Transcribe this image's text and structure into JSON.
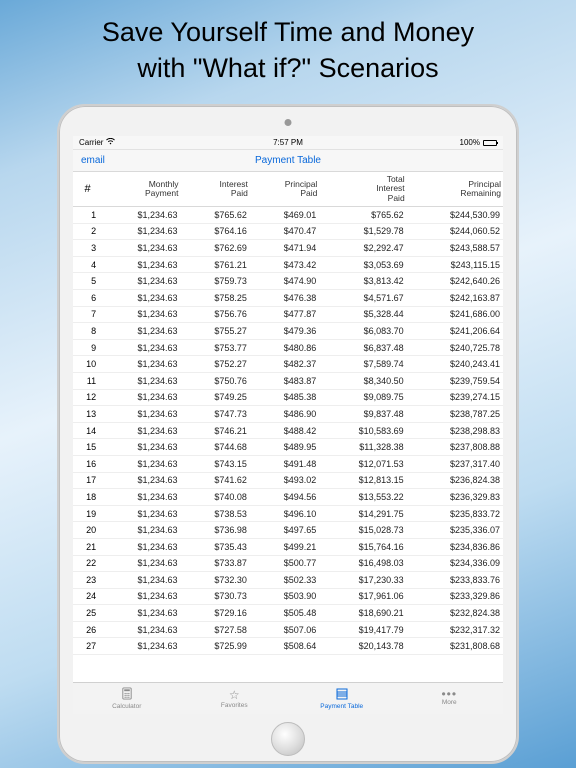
{
  "headline_line1": "Save Yourself Time and Money",
  "headline_line2": "with \"What if?\" Scenarios",
  "statusbar": {
    "carrier": "Carrier",
    "time": "7:57 PM",
    "battery": "100%"
  },
  "navbar": {
    "left": "email",
    "title": "Payment Table"
  },
  "columns": {
    "num": "#",
    "monthly": "Monthly\nPayment",
    "interest": "Interest\nPaid",
    "principal": "Principal\nPaid",
    "total_interest": "Total\nInterest\nPaid",
    "remaining": "Principal\nRemaining"
  },
  "chart_data": {
    "type": "table",
    "title": "Payment Table",
    "columns": [
      "#",
      "Monthly Payment",
      "Interest Paid",
      "Principal Paid",
      "Total Interest Paid",
      "Principal Remaining"
    ],
    "rows": [
      [
        1,
        "$1,234.63",
        "$765.62",
        "$469.01",
        "$765.62",
        "$244,530.99"
      ],
      [
        2,
        "$1,234.63",
        "$764.16",
        "$470.47",
        "$1,529.78",
        "$244,060.52"
      ],
      [
        3,
        "$1,234.63",
        "$762.69",
        "$471.94",
        "$2,292.47",
        "$243,588.57"
      ],
      [
        4,
        "$1,234.63",
        "$761.21",
        "$473.42",
        "$3,053.69",
        "$243,115.15"
      ],
      [
        5,
        "$1,234.63",
        "$759.73",
        "$474.90",
        "$3,813.42",
        "$242,640.26"
      ],
      [
        6,
        "$1,234.63",
        "$758.25",
        "$476.38",
        "$4,571.67",
        "$242,163.87"
      ],
      [
        7,
        "$1,234.63",
        "$756.76",
        "$477.87",
        "$5,328.44",
        "$241,686.00"
      ],
      [
        8,
        "$1,234.63",
        "$755.27",
        "$479.36",
        "$6,083.70",
        "$241,206.64"
      ],
      [
        9,
        "$1,234.63",
        "$753.77",
        "$480.86",
        "$6,837.48",
        "$240,725.78"
      ],
      [
        10,
        "$1,234.63",
        "$752.27",
        "$482.37",
        "$7,589.74",
        "$240,243.41"
      ],
      [
        11,
        "$1,234.63",
        "$750.76",
        "$483.87",
        "$8,340.50",
        "$239,759.54"
      ],
      [
        12,
        "$1,234.63",
        "$749.25",
        "$485.38",
        "$9,089.75",
        "$239,274.15"
      ],
      [
        13,
        "$1,234.63",
        "$747.73",
        "$486.90",
        "$9,837.48",
        "$238,787.25"
      ],
      [
        14,
        "$1,234.63",
        "$746.21",
        "$488.42",
        "$10,583.69",
        "$238,298.83"
      ],
      [
        15,
        "$1,234.63",
        "$744.68",
        "$489.95",
        "$11,328.38",
        "$237,808.88"
      ],
      [
        16,
        "$1,234.63",
        "$743.15",
        "$491.48",
        "$12,071.53",
        "$237,317.40"
      ],
      [
        17,
        "$1,234.63",
        "$741.62",
        "$493.02",
        "$12,813.15",
        "$236,824.38"
      ],
      [
        18,
        "$1,234.63",
        "$740.08",
        "$494.56",
        "$13,553.22",
        "$236,329.83"
      ],
      [
        19,
        "$1,234.63",
        "$738.53",
        "$496.10",
        "$14,291.75",
        "$235,833.72"
      ],
      [
        20,
        "$1,234.63",
        "$736.98",
        "$497.65",
        "$15,028.73",
        "$235,336.07"
      ],
      [
        21,
        "$1,234.63",
        "$735.43",
        "$499.21",
        "$15,764.16",
        "$234,836.86"
      ],
      [
        22,
        "$1,234.63",
        "$733.87",
        "$500.77",
        "$16,498.03",
        "$234,336.09"
      ],
      [
        23,
        "$1,234.63",
        "$732.30",
        "$502.33",
        "$17,230.33",
        "$233,833.76"
      ],
      [
        24,
        "$1,234.63",
        "$730.73",
        "$503.90",
        "$17,961.06",
        "$233,329.86"
      ],
      [
        25,
        "$1,234.63",
        "$729.16",
        "$505.48",
        "$18,690.21",
        "$232,824.38"
      ],
      [
        26,
        "$1,234.63",
        "$727.58",
        "$507.06",
        "$19,417.79",
        "$232,317.32"
      ],
      [
        27,
        "$1,234.63",
        "$725.99",
        "$508.64",
        "$20,143.78",
        "$231,808.68"
      ]
    ]
  },
  "tabs": {
    "calculator": "Calculator",
    "favorites": "Favorites",
    "payment_table": "Payment Table",
    "more": "More"
  }
}
